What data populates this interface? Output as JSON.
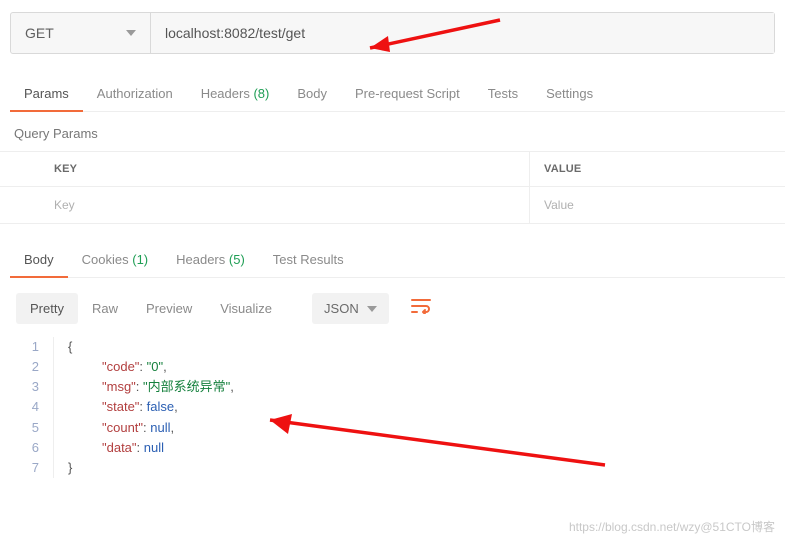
{
  "request": {
    "method": "GET",
    "url": "localhost:8082/test/get"
  },
  "tabs": {
    "params": "Params",
    "auth": "Authorization",
    "headers": "Headers",
    "headers_count": "(8)",
    "body": "Body",
    "prereq": "Pre-request Script",
    "tests": "Tests",
    "settings": "Settings"
  },
  "query": {
    "title": "Query Params",
    "key_header": "KEY",
    "value_header": "VALUE",
    "key_placeholder": "Key",
    "value_placeholder": "Value"
  },
  "response_tabs": {
    "body": "Body",
    "cookies": "Cookies",
    "cookies_count": "(1)",
    "headers": "Headers",
    "headers_count": "(5)",
    "tests": "Test Results"
  },
  "toolbar": {
    "pretty": "Pretty",
    "raw": "Raw",
    "preview": "Preview",
    "visualize": "Visualize",
    "format": "JSON"
  },
  "code": {
    "lines": [
      "1",
      "2",
      "3",
      "4",
      "5",
      "6",
      "7"
    ],
    "keys": {
      "code": "\"code\"",
      "msg": "\"msg\"",
      "state": "\"state\"",
      "count": "\"count\"",
      "data": "\"data\""
    },
    "vals": {
      "code": "\"0\"",
      "msg": "\"内部系统异常\"",
      "state": "false",
      "count": "null",
      "data": "null"
    }
  },
  "watermark": "https://blog.csdn.net/wzy@51CTO博客"
}
